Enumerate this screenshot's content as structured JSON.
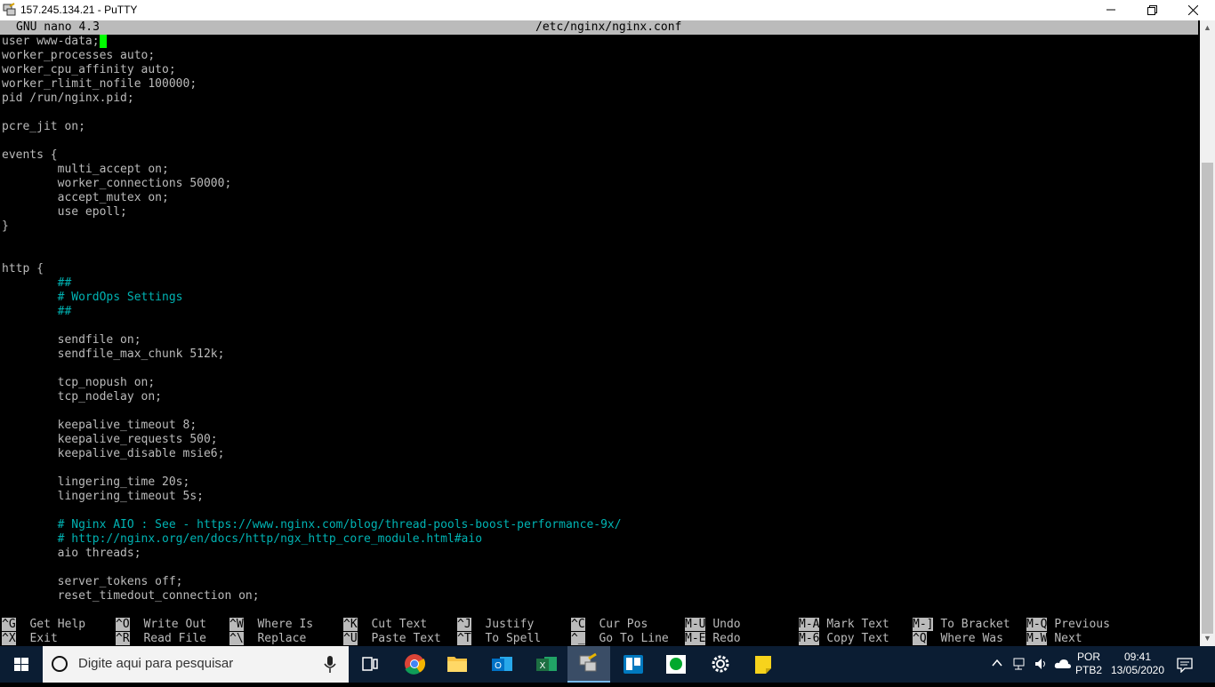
{
  "window": {
    "title": "157.245.134.21 - PuTTY",
    "minimize_glyph": "—",
    "close_glyph": "✕"
  },
  "nano": {
    "version": "GNU nano 4.3",
    "filename": "/etc/nginx/nginx.conf",
    "lines": [
      {
        "text": "user www-data;",
        "type": "code",
        "cursor": true
      },
      {
        "text": "worker_processes auto;",
        "type": "code"
      },
      {
        "text": "worker_cpu_affinity auto;",
        "type": "code"
      },
      {
        "text": "worker_rlimit_nofile 100000;",
        "type": "code"
      },
      {
        "text": "pid /run/nginx.pid;",
        "type": "code"
      },
      {
        "text": "",
        "type": "code"
      },
      {
        "text": "pcre_jit on;",
        "type": "code"
      },
      {
        "text": "",
        "type": "code"
      },
      {
        "text": "events {",
        "type": "code"
      },
      {
        "text": "        multi_accept on;",
        "type": "code"
      },
      {
        "text": "        worker_connections 50000;",
        "type": "code"
      },
      {
        "text": "        accept_mutex on;",
        "type": "code"
      },
      {
        "text": "        use epoll;",
        "type": "code"
      },
      {
        "text": "}",
        "type": "code"
      },
      {
        "text": "",
        "type": "code"
      },
      {
        "text": "",
        "type": "code"
      },
      {
        "text": "http {",
        "type": "code"
      },
      {
        "text": "        ##",
        "type": "comment"
      },
      {
        "text": "        # WordOps Settings",
        "type": "comment"
      },
      {
        "text": "        ##",
        "type": "comment"
      },
      {
        "text": "",
        "type": "code"
      },
      {
        "text": "        sendfile on;",
        "type": "code"
      },
      {
        "text": "        sendfile_max_chunk 512k;",
        "type": "code"
      },
      {
        "text": "",
        "type": "code"
      },
      {
        "text": "        tcp_nopush on;",
        "type": "code"
      },
      {
        "text": "        tcp_nodelay on;",
        "type": "code"
      },
      {
        "text": "",
        "type": "code"
      },
      {
        "text": "        keepalive_timeout 8;",
        "type": "code"
      },
      {
        "text": "        keepalive_requests 500;",
        "type": "code"
      },
      {
        "text": "        keepalive_disable msie6;",
        "type": "code"
      },
      {
        "text": "",
        "type": "code"
      },
      {
        "text": "        lingering_time 20s;",
        "type": "code"
      },
      {
        "text": "        lingering_timeout 5s;",
        "type": "code"
      },
      {
        "text": "",
        "type": "code"
      },
      {
        "text": "        # Nginx AIO : See - https://www.nginx.com/blog/thread-pools-boost-performance-9x/",
        "type": "comment"
      },
      {
        "text": "        # http://nginx.org/en/docs/http/ngx_http_core_module.html#aio",
        "type": "comment"
      },
      {
        "text": "        aio threads;",
        "type": "code"
      },
      {
        "text": "",
        "type": "code"
      },
      {
        "text": "        server_tokens off;",
        "type": "code"
      },
      {
        "text": "        reset_timedout_connection on;",
        "type": "code"
      }
    ],
    "shortcuts_row1": [
      {
        "key": "^G",
        "label": "Get Help"
      },
      {
        "key": "^O",
        "label": "Write Out"
      },
      {
        "key": "^W",
        "label": "Where Is"
      },
      {
        "key": "^K",
        "label": "Cut Text"
      },
      {
        "key": "^J",
        "label": "Justify"
      },
      {
        "key": "^C",
        "label": "Cur Pos"
      },
      {
        "key": "M-U",
        "label": "Undo"
      },
      {
        "key": "M-A",
        "label": "Mark Text"
      },
      {
        "key": "M-]",
        "label": "To Bracket"
      },
      {
        "key": "M-Q",
        "label": "Previous"
      }
    ],
    "shortcuts_row2": [
      {
        "key": "^X",
        "label": "Exit"
      },
      {
        "key": "^R",
        "label": "Read File"
      },
      {
        "key": "^\\",
        "label": "Replace"
      },
      {
        "key": "^U",
        "label": "Paste Text"
      },
      {
        "key": "^T",
        "label": "To Spell"
      },
      {
        "key": "^_",
        "label": "Go To Line"
      },
      {
        "key": "M-E",
        "label": "Redo"
      },
      {
        "key": "M-6",
        "label": "Copy Text"
      },
      {
        "key": "^Q",
        "label": "Where Was"
      },
      {
        "key": "M-W",
        "label": "Next"
      }
    ]
  },
  "taskbar": {
    "search_placeholder": "Digite aqui para pesquisar",
    "lang": "POR",
    "layout": "PTB2",
    "time": "09:41",
    "date": "13/05/2020",
    "colors": {
      "accent": "#76b9ed",
      "excel": "#1d6f42",
      "outlook": "#0072c6",
      "trello": "#0079bf",
      "evernote": "#00a82d",
      "sticky": "#f7d31c"
    }
  }
}
